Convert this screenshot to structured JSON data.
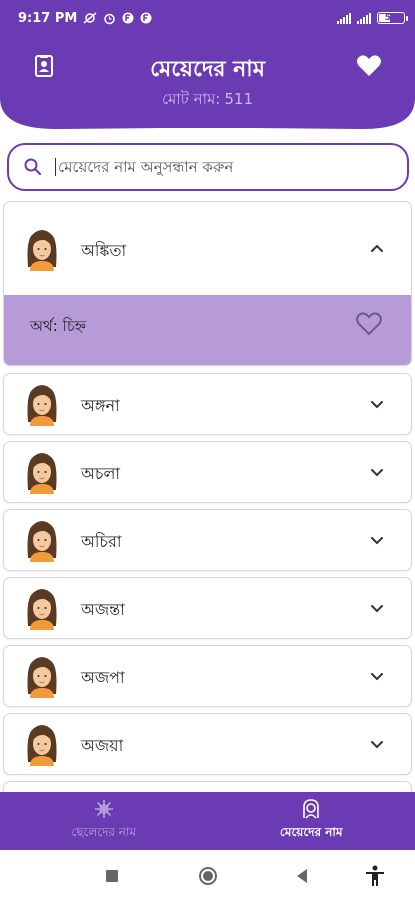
{
  "status_bar": {
    "time": "9:17 PM",
    "battery_level": "51"
  },
  "header": {
    "title": "মেয়েদের নাম",
    "subtitle_label": "মোট নাম:",
    "total_count": "511",
    "left_icon": "contact-card-icon",
    "right_icon": "heart-icon"
  },
  "search": {
    "placeholder": "মেয়েদের নাম অনুসন্ধান করুন",
    "value": ""
  },
  "names": [
    {
      "name": "অঙ্কিতা",
      "expanded": true,
      "meaning_label": "অর্থ:",
      "meaning": "চিহ্ন"
    },
    {
      "name": "অঙ্গনা",
      "expanded": false
    },
    {
      "name": "অচলা",
      "expanded": false
    },
    {
      "name": "অচিরা",
      "expanded": false
    },
    {
      "name": "অজন্তা",
      "expanded": false
    },
    {
      "name": "অজপা",
      "expanded": false
    },
    {
      "name": "অজয়া",
      "expanded": false
    }
  ],
  "meaning_text": "অর্থ: চিহ্ন",
  "bottom_nav": [
    {
      "label": "ছেলেদের নাম",
      "icon": "boy-face-icon",
      "active": false
    },
    {
      "label": "মেয়েদের নাম",
      "icon": "girl-face-icon",
      "active": true
    }
  ],
  "colors": {
    "primary": "#6a3bb3",
    "expanded_bg": "#b79bd8",
    "subtitle": "#c9b8e8"
  }
}
